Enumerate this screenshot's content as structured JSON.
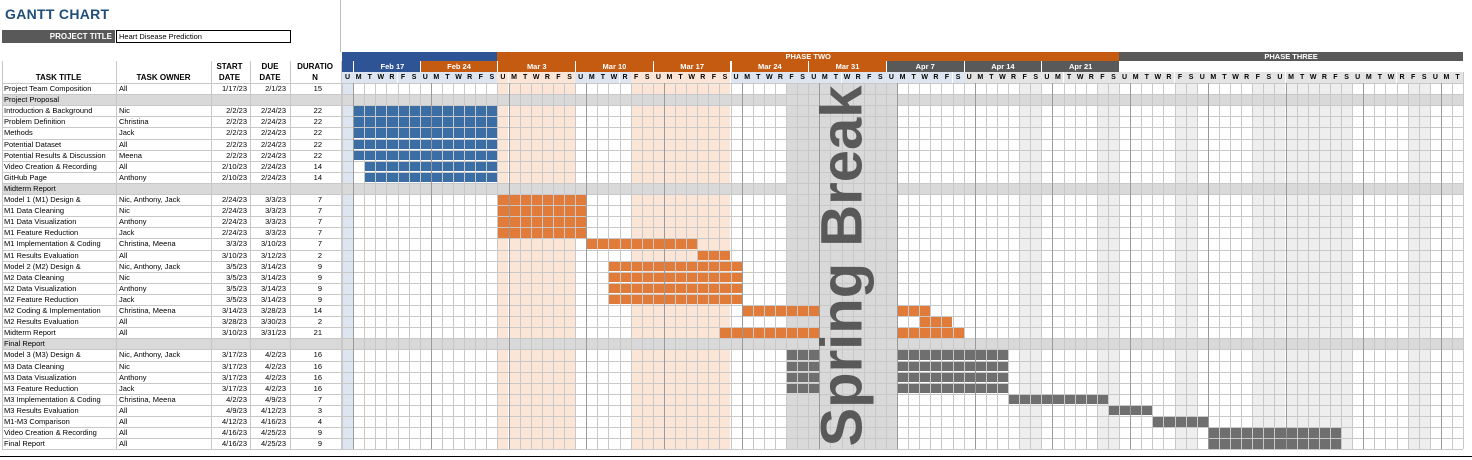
{
  "title": "GANTT CHART",
  "project_title_label": "PROJECT TITLE",
  "project_title_value": "Heart Disease Prediction",
  "columns": {
    "task": "TASK TITLE",
    "owner": "TASK OWNER",
    "start_l1": "START",
    "start_l2": "DATE",
    "due_l1": "DUE",
    "due_l2": "DATE",
    "dur_l1": "DURATIO",
    "dur_l2": "N"
  },
  "phases": [
    "PHASE TWO",
    "PHASE THREE"
  ],
  "weeks": [
    "Feb 17",
    "Feb 24",
    "Mar 3",
    "Mar 10",
    "Mar 17",
    "Mar 24",
    "Mar 31",
    "Apr 7",
    "Apr 14",
    "Apr 21"
  ],
  "day_letters": [
    "M",
    "T",
    "W",
    "R",
    "F",
    "S",
    "U"
  ],
  "spring_break": "Spring Break",
  "colors": {
    "blue": "#3a6ea5",
    "orange": "#e07b39",
    "gray": "#6f6f6f",
    "peach": "#fbe5d6",
    "weekend_light": "#eeeeee",
    "phase_blue": "#2f5496",
    "phase_orange": "#c55a11",
    "phase_gray": "#595959"
  },
  "rows": [
    {
      "type": "task",
      "task": "Project Team Composition",
      "owner": "All",
      "start": "1/17/23",
      "due": "2/1/23",
      "dur": "15"
    },
    {
      "type": "section",
      "task": "Project Proposal"
    },
    {
      "type": "task",
      "task": "Introduction & Background",
      "owner": "Nic",
      "start": "2/2/23",
      "due": "2/24/23",
      "dur": "22"
    },
    {
      "type": "task",
      "task": "Problem Definition",
      "owner": "Christina",
      "start": "2/2/23",
      "due": "2/24/23",
      "dur": "22"
    },
    {
      "type": "task",
      "task": "Methods",
      "owner": "Jack",
      "start": "2/2/23",
      "due": "2/24/23",
      "dur": "22"
    },
    {
      "type": "task",
      "task": "Potential Dataset",
      "owner": "All",
      "start": "2/2/23",
      "due": "2/24/23",
      "dur": "22"
    },
    {
      "type": "task",
      "task": "Potential Results & Discussion",
      "owner": "Meena",
      "start": "2/2/23",
      "due": "2/24/23",
      "dur": "22"
    },
    {
      "type": "task",
      "task": "Video Creation & Recording",
      "owner": "All",
      "start": "2/10/23",
      "due": "2/24/23",
      "dur": "14"
    },
    {
      "type": "task",
      "task": "GitHub Page",
      "owner": "Anthony",
      "start": "2/10/23",
      "due": "2/24/23",
      "dur": "14"
    },
    {
      "type": "section",
      "task": "Midterm Report"
    },
    {
      "type": "task",
      "task": "Model 1 (M1) Design &",
      "owner": "Nic, Anthony, Jack",
      "start": "2/24/23",
      "due": "3/3/23",
      "dur": "7"
    },
    {
      "type": "task",
      "task": "M1 Data Cleaning",
      "owner": "Nic",
      "start": "2/24/23",
      "due": "3/3/23",
      "dur": "7"
    },
    {
      "type": "task",
      "task": "M1 Data Visualization",
      "owner": "Anthony",
      "start": "2/24/23",
      "due": "3/3/23",
      "dur": "7"
    },
    {
      "type": "task",
      "task": "M1 Feature Reduction",
      "owner": "Jack",
      "start": "2/24/23",
      "due": "3/3/23",
      "dur": "7"
    },
    {
      "type": "task",
      "task": "M1 Implementation & Coding",
      "owner": "Christina, Meena",
      "start": "3/3/23",
      "due": "3/10/23",
      "dur": "7"
    },
    {
      "type": "task",
      "task": "M1 Results Evaluation",
      "owner": "All",
      "start": "3/10/23",
      "due": "3/12/23",
      "dur": "2"
    },
    {
      "type": "task",
      "task": "Model 2 (M2) Design &",
      "owner": "Nic, Anthony, Jack",
      "start": "3/5/23",
      "due": "3/14/23",
      "dur": "9"
    },
    {
      "type": "task",
      "task": "M2 Data Cleaning",
      "owner": "Nic",
      "start": "3/5/23",
      "due": "3/14/23",
      "dur": "9"
    },
    {
      "type": "task",
      "task": "M2 Data Visualization",
      "owner": "Anthony",
      "start": "3/5/23",
      "due": "3/14/23",
      "dur": "9"
    },
    {
      "type": "task",
      "task": "M2 Feature Reduction",
      "owner": "Jack",
      "start": "3/5/23",
      "due": "3/14/23",
      "dur": "9"
    },
    {
      "type": "task",
      "task": "M2 Coding & Implementation",
      "owner": "Christina, Meena",
      "start": "3/14/23",
      "due": "3/28/23",
      "dur": "14"
    },
    {
      "type": "task",
      "task": "M2 Results Evaluation",
      "owner": "All",
      "start": "3/28/23",
      "due": "3/30/23",
      "dur": "2"
    },
    {
      "type": "task",
      "task": "Midterm Report",
      "owner": "All",
      "start": "3/10/23",
      "due": "3/31/23",
      "dur": "21"
    },
    {
      "type": "section",
      "task": "Final Report"
    },
    {
      "type": "task",
      "task": "Model 3 (M3) Design &",
      "owner": "Nic, Anthony, Jack",
      "start": "3/17/23",
      "due": "4/2/23",
      "dur": "16"
    },
    {
      "type": "task",
      "task": "M3 Data Cleaning",
      "owner": "Nic",
      "start": "3/17/23",
      "due": "4/2/23",
      "dur": "16"
    },
    {
      "type": "task",
      "task": "M3 Data Visualization",
      "owner": "Anthony",
      "start": "3/17/23",
      "due": "4/2/23",
      "dur": "16"
    },
    {
      "type": "task",
      "task": "M3 Feature Reduction",
      "owner": "Jack",
      "start": "3/17/23",
      "due": "4/2/23",
      "dur": "16"
    },
    {
      "type": "task",
      "task": "M3 Implementation & Coding",
      "owner": "Christina, Meena",
      "start": "4/2/23",
      "due": "4/9/23",
      "dur": "7"
    },
    {
      "type": "task",
      "task": "M3 Results Evaluation",
      "owner": "All",
      "start": "4/9/23",
      "due": "4/12/23",
      "dur": "3"
    },
    {
      "type": "task",
      "task": "M1-M3 Comparison",
      "owner": "All",
      "start": "4/12/23",
      "due": "4/16/23",
      "dur": "4"
    },
    {
      "type": "task",
      "task": "Video Creation & Recording",
      "owner": "All",
      "start": "4/16/23",
      "due": "4/25/23",
      "dur": "9"
    },
    {
      "type": "task",
      "task": "Final Report",
      "owner": "All",
      "start": "4/16/23",
      "due": "4/25/23",
      "dur": "9"
    }
  ],
  "bars": [
    {
      "row": 2,
      "from": "2/13/23",
      "to": "2/25/23",
      "color": "blue"
    },
    {
      "row": 3,
      "from": "2/13/23",
      "to": "2/25/23",
      "color": "blue"
    },
    {
      "row": 4,
      "from": "2/13/23",
      "to": "2/25/23",
      "color": "blue"
    },
    {
      "row": 5,
      "from": "2/13/23",
      "to": "2/25/23",
      "color": "blue"
    },
    {
      "row": 6,
      "from": "2/13/23",
      "to": "2/25/23",
      "color": "blue"
    },
    {
      "row": 7,
      "from": "2/14/23",
      "to": "2/25/23",
      "color": "blue"
    },
    {
      "row": 8,
      "from": "2/14/23",
      "to": "2/25/23",
      "color": "blue"
    },
    {
      "row": 10,
      "from": "2/26/23",
      "to": "3/5/23",
      "color": "orange"
    },
    {
      "row": 11,
      "from": "2/26/23",
      "to": "3/5/23",
      "color": "orange"
    },
    {
      "row": 12,
      "from": "2/26/23",
      "to": "3/5/23",
      "color": "orange"
    },
    {
      "row": 13,
      "from": "2/26/23",
      "to": "3/5/23",
      "color": "orange"
    },
    {
      "row": 14,
      "from": "3/6/23",
      "to": "3/15/23",
      "color": "orange"
    },
    {
      "row": 15,
      "from": "3/16/23",
      "to": "3/18/23",
      "color": "orange"
    },
    {
      "row": 16,
      "from": "3/8/23",
      "to": "3/19/23",
      "color": "orange"
    },
    {
      "row": 17,
      "from": "3/8/23",
      "to": "3/19/23",
      "color": "orange"
    },
    {
      "row": 18,
      "from": "3/8/23",
      "to": "3/19/23",
      "color": "orange"
    },
    {
      "row": 19,
      "from": "3/8/23",
      "to": "3/19/23",
      "color": "orange"
    },
    {
      "row": 20,
      "from": "3/20/23",
      "to": "3/26/23",
      "color": "orange"
    },
    {
      "row": 20,
      "from": "4/3/23",
      "to": "4/5/23",
      "color": "orange"
    },
    {
      "row": 21,
      "from": "4/5/23",
      "to": "4/7/23",
      "color": "orange"
    },
    {
      "row": 22,
      "from": "3/18/23",
      "to": "3/26/23",
      "color": "orange"
    },
    {
      "row": 22,
      "from": "4/3/23",
      "to": "4/8/23",
      "color": "orange"
    },
    {
      "row": 24,
      "from": "3/24/23",
      "to": "3/26/23",
      "color": "gray"
    },
    {
      "row": 24,
      "from": "4/3/23",
      "to": "4/12/23",
      "color": "gray"
    },
    {
      "row": 25,
      "from": "3/24/23",
      "to": "3/26/23",
      "color": "gray"
    },
    {
      "row": 25,
      "from": "4/3/23",
      "to": "4/12/23",
      "color": "gray"
    },
    {
      "row": 26,
      "from": "3/24/23",
      "to": "3/26/23",
      "color": "gray"
    },
    {
      "row": 26,
      "from": "4/3/23",
      "to": "4/12/23",
      "color": "gray"
    },
    {
      "row": 27,
      "from": "3/24/23",
      "to": "3/26/23",
      "color": "gray"
    },
    {
      "row": 27,
      "from": "4/3/23",
      "to": "4/12/23",
      "color": "gray"
    },
    {
      "row": 28,
      "from": "4/13/23",
      "to": "4/21/23",
      "color": "gray"
    },
    {
      "row": 29,
      "from": "4/22/23",
      "to": "4/25/23",
      "color": "gray"
    },
    {
      "row": 30,
      "from": "4/26/23",
      "to": "4/30/23",
      "color": "gray"
    },
    {
      "row": 31,
      "from": "5/1/23",
      "to": "5/12/23",
      "color": "gray"
    },
    {
      "row": 32,
      "from": "5/1/23",
      "to": "5/12/23",
      "color": "gray"
    }
  ]
}
